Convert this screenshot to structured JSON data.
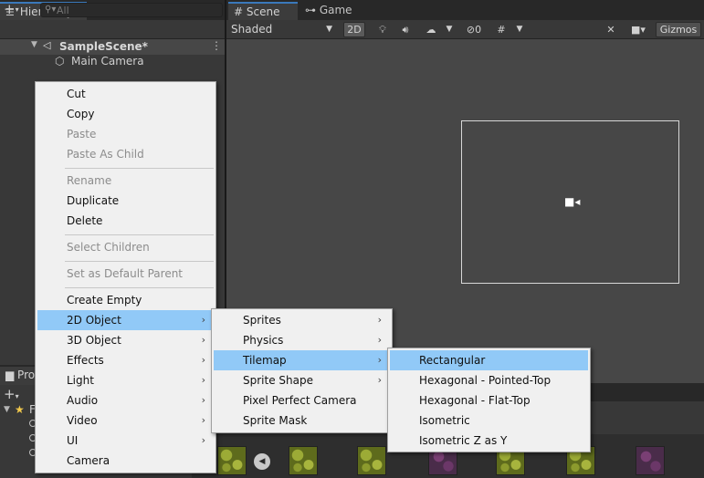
{
  "hierarchy": {
    "tab_label": "Hierarchy",
    "add_label": "+",
    "search_placeholder": "All",
    "scene_name": "SampleScene*",
    "children": [
      "Main Camera"
    ]
  },
  "scene_view": {
    "tabs": [
      {
        "label": "Scene",
        "active": true
      },
      {
        "label": "Game",
        "active": false
      }
    ],
    "shading_mode": "Shaded",
    "toolbar": {
      "mode_2d": "2D",
      "hidden_count": "0",
      "gizmos_label": "Gizmos"
    }
  },
  "project": {
    "tab_label": "Pro",
    "tree_partial": "F"
  },
  "context_menu": {
    "items": [
      {
        "label": "Cut",
        "enabled": true
      },
      {
        "label": "Copy",
        "enabled": true
      },
      {
        "label": "Paste",
        "enabled": false
      },
      {
        "label": "Paste As Child",
        "enabled": false
      },
      {
        "label": "Rename",
        "enabled": false
      },
      {
        "label": "Duplicate",
        "enabled": true
      },
      {
        "label": "Delete",
        "enabled": true
      },
      {
        "label": "Select Children",
        "enabled": false
      },
      {
        "label": "Set as Default Parent",
        "enabled": false
      },
      {
        "label": "Create Empty",
        "enabled": true
      },
      {
        "label": "2D Object",
        "enabled": true,
        "submenu": true,
        "highlighted": true
      },
      {
        "label": "3D Object",
        "enabled": true,
        "submenu": true
      },
      {
        "label": "Effects",
        "enabled": true,
        "submenu": true
      },
      {
        "label": "Light",
        "enabled": true,
        "submenu": true
      },
      {
        "label": "Audio",
        "enabled": true,
        "submenu": true
      },
      {
        "label": "Video",
        "enabled": true,
        "submenu": true
      },
      {
        "label": "UI",
        "enabled": true,
        "submenu": true
      },
      {
        "label": "Camera",
        "enabled": true
      }
    ]
  },
  "submenu_2d": {
    "items": [
      {
        "label": "Sprites",
        "submenu": true
      },
      {
        "label": "Physics",
        "submenu": true
      },
      {
        "label": "Tilemap",
        "submenu": true,
        "highlighted": true
      },
      {
        "label": "Sprite Shape",
        "submenu": true
      },
      {
        "label": "Pixel Perfect Camera"
      },
      {
        "label": "Sprite Mask"
      }
    ]
  },
  "submenu_tilemap": {
    "items": [
      {
        "label": "Rectangular",
        "highlighted": true
      },
      {
        "label": "Hexagonal - Pointed-Top"
      },
      {
        "label": "Hexagonal - Flat-Top"
      },
      {
        "label": "Isometric"
      },
      {
        "label": "Isometric Z as Y"
      }
    ]
  },
  "colors": {
    "menu_bg": "#f0f0f0",
    "menu_highlight": "#91c9f7",
    "panel_bg": "#383838",
    "viewport_bg": "#474747",
    "tab_accent": "#3a79bb"
  }
}
